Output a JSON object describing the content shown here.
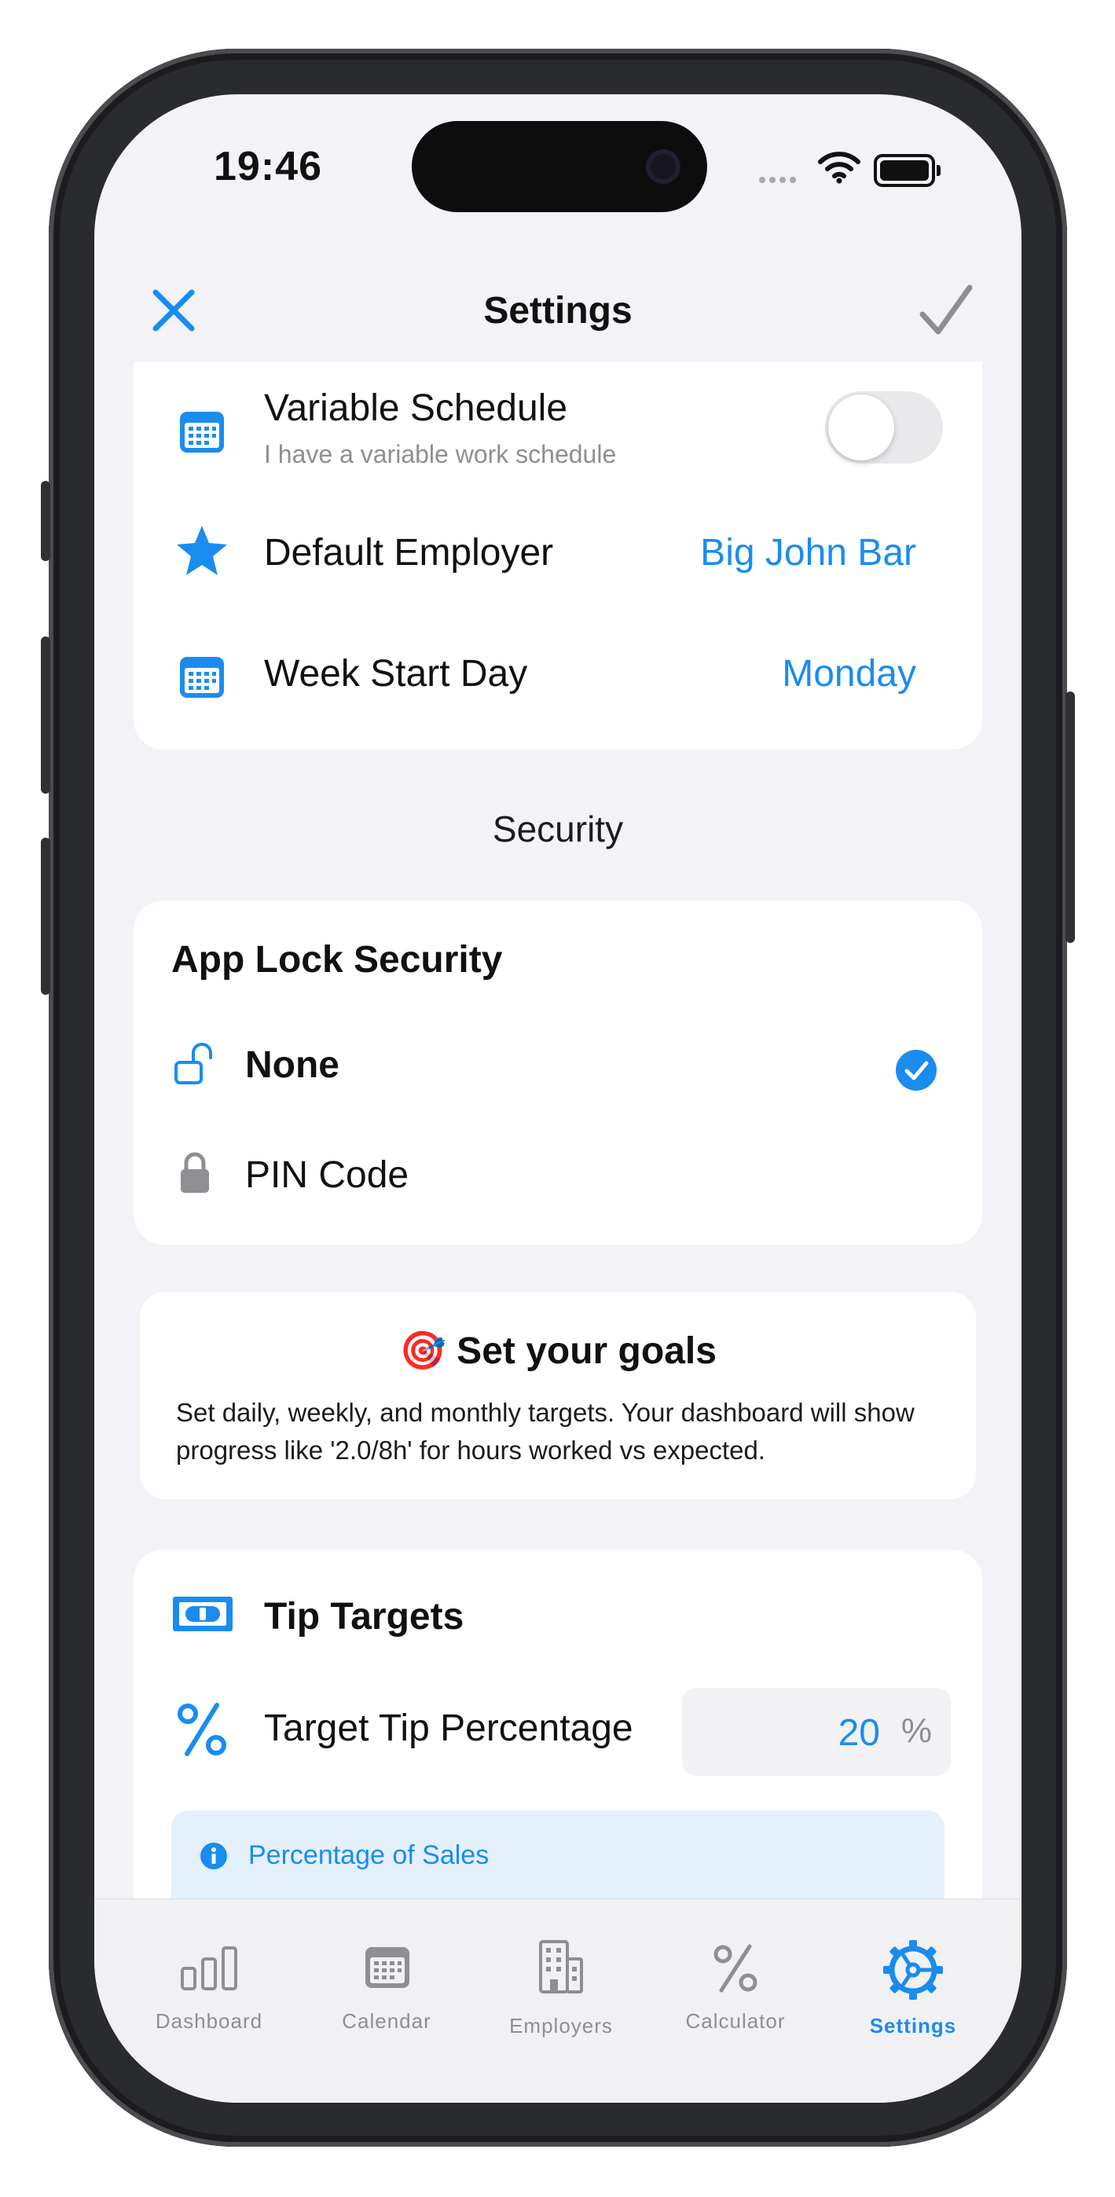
{
  "status_bar": {
    "time": "19:46"
  },
  "nav": {
    "title": "Settings",
    "close_icon": "close-icon",
    "done_icon": "checkmark-icon"
  },
  "schedule_card": {
    "variable_schedule": {
      "label": "Variable Schedule",
      "subtitle": "I have a variable work schedule",
      "toggle_on": false
    },
    "default_employer": {
      "label": "Default Employer",
      "value": "Big John Bar"
    },
    "week_start": {
      "label": "Week Start Day",
      "value": "Monday"
    }
  },
  "security": {
    "header": "Security",
    "title": "App Lock Security",
    "options": [
      {
        "label": "None",
        "selected": true
      },
      {
        "label": "PIN Code",
        "selected": false
      }
    ]
  },
  "goals": {
    "emoji": "🎯",
    "title": "Set your goals",
    "description": "Set daily, weekly, and monthly targets. Your dashboard will show progress like '2.0/8h' for hours worked vs expected."
  },
  "tip_targets": {
    "title": "Tip Targets",
    "percentage_label": "Target Tip Percentage",
    "percentage_value": "20",
    "percentage_unit": "%",
    "info_title": "Percentage of Sales"
  },
  "tabs": [
    {
      "label": "Dashboard",
      "icon": "chart-bar-icon",
      "active": false
    },
    {
      "label": "Calendar",
      "icon": "calendar-icon",
      "active": false
    },
    {
      "label": "Employers",
      "icon": "building-icon",
      "active": false
    },
    {
      "label": "Calculator",
      "icon": "percent-icon",
      "active": false
    },
    {
      "label": "Settings",
      "icon": "gear-icon",
      "active": true
    }
  ],
  "colors": {
    "accent": "#1a8cf0",
    "background": "#f2f2f7",
    "card": "#ffffff",
    "info_bg": "#e4f0fc"
  }
}
